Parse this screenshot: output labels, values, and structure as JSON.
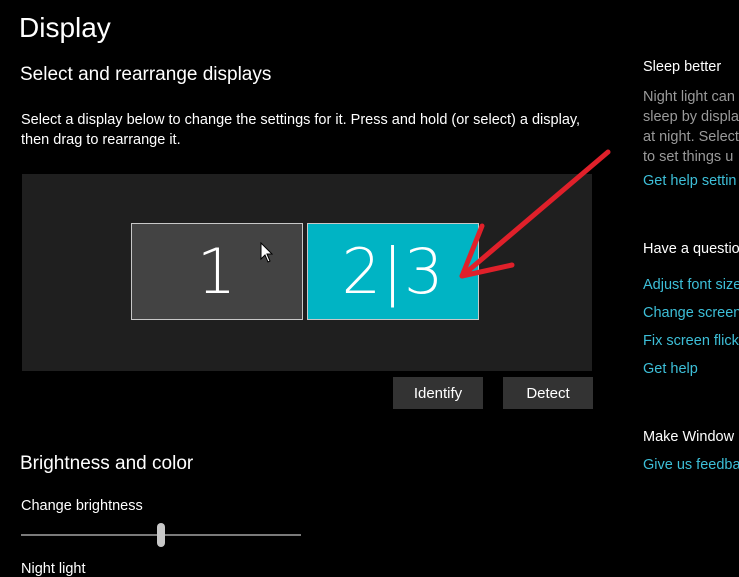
{
  "page": {
    "title": "Display"
  },
  "arrange": {
    "heading": "Select and rearrange displays",
    "description": "Select a display below to change the settings for it. Press and hold (or select) a display, then drag to rearrange it.",
    "monitors": [
      {
        "label": "1",
        "color": "#434343"
      },
      {
        "label": "2|3",
        "color": "#00b4c4",
        "selected": true
      }
    ],
    "identify_label": "Identify",
    "detect_label": "Detect"
  },
  "brightness": {
    "heading": "Brightness and color",
    "slider_label": "Change brightness",
    "slider_level_percent": 50,
    "night_light_label": "Night light"
  },
  "sidebar": {
    "sleep_better": {
      "heading": "Sleep better",
      "text_lines": [
        "Night light can",
        "sleep by displa",
        "at night. Select",
        "to set things u"
      ],
      "link": "Get help settin"
    },
    "question": {
      "heading": "Have a questio",
      "links": [
        "Adjust font size",
        "Change screen",
        "Fix screen flick",
        "Get help"
      ]
    },
    "make_windows": {
      "heading": "Make Window",
      "link": "Give us feedba"
    }
  },
  "colors": {
    "accent": "#00b4c4",
    "link": "#3dbfd8",
    "annotation_arrow": "#e0202a"
  }
}
